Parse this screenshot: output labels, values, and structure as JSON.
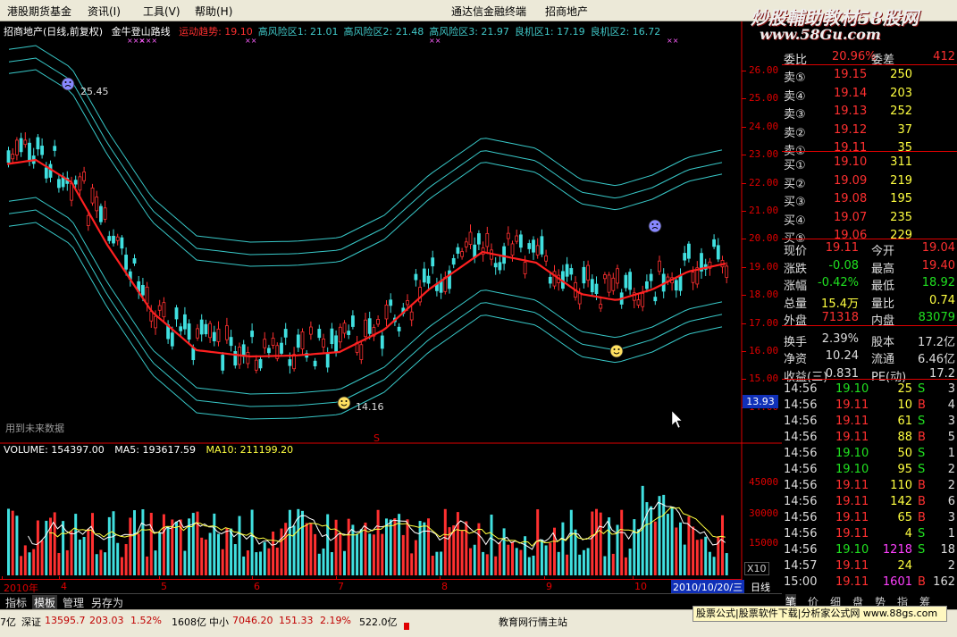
{
  "menu": {
    "items": [
      "港股期货基金",
      "资讯(I)",
      "工具(V)",
      "帮助(H)"
    ],
    "center_a": "通达信金融终端",
    "center_b": "招商地产"
  },
  "watermark": {
    "line1": "炒股輔助教材58股网",
    "line2": "www.58Gu.com"
  },
  "chart": {
    "title": "招商地产(日线,前复权)",
    "indicator_name": "金牛登山路线",
    "indicators": [
      {
        "label": "运动趋势: 19.10",
        "color": "#ff3030"
      },
      {
        "label": "高风险区1: 21.01",
        "color": "#40c8c8"
      },
      {
        "label": "高风险区2: 21.48",
        "color": "#40c8c8"
      },
      {
        "label": "高风险区3: 21.97",
        "color": "#40c8c8"
      },
      {
        "label": "良机区1: 17.19",
        "color": "#40c8c8"
      },
      {
        "label": "良机区2: 16.72",
        "color": "#40c8c8"
      }
    ],
    "high_label": "25.45",
    "low_label": "14.16",
    "current_price": "13.93",
    "price_ticks": [
      "26.00",
      "25.00",
      "24.00",
      "23.00",
      "22.00",
      "21.00",
      "20.00",
      "19.00",
      "18.00",
      "17.00",
      "16.00",
      "15.00",
      "14.00"
    ],
    "future_text": "用到未来数据",
    "volume": {
      "label": "VOLUME: 154397.00",
      "ma5": "MA5: 193617.59",
      "ma10": "MA10: 211199.20",
      "ticks": [
        "45000",
        "30000",
        "15000"
      ],
      "scale": "X10"
    },
    "x_labels": [
      "2010年",
      "4",
      "5",
      "6",
      "7",
      "8",
      "9",
      "10"
    ],
    "date_box": "2010/10/20/三",
    "period": "日线"
  },
  "colors": {
    "up": "#ff3030",
    "down": "#40e0e0",
    "trend": "#ff2020",
    "band": "#38c8c8",
    "axis": "#e00000"
  },
  "quote": {
    "ratio": {
      "l1": "委比",
      "v1": "20.96%",
      "l2": "委差",
      "v2": "412"
    },
    "asks": [
      {
        "l": "卖⑤",
        "p": "19.15",
        "v": "250"
      },
      {
        "l": "卖④",
        "p": "19.14",
        "v": "203"
      },
      {
        "l": "卖③",
        "p": "19.13",
        "v": "252"
      },
      {
        "l": "卖②",
        "p": "19.12",
        "v": "37"
      },
      {
        "l": "卖①",
        "p": "19.11",
        "v": "35"
      }
    ],
    "bids": [
      {
        "l": "买①",
        "p": "19.10",
        "v": "311"
      },
      {
        "l": "买②",
        "p": "19.09",
        "v": "219"
      },
      {
        "l": "买③",
        "p": "19.08",
        "v": "195"
      },
      {
        "l": "买④",
        "p": "19.07",
        "v": "235"
      },
      {
        "l": "买⑤",
        "p": "19.06",
        "v": "229"
      }
    ],
    "stats": [
      {
        "l1": "现价",
        "v1": "19.11",
        "l2": "今开",
        "v2": "19.04",
        "c1": "#ff3030",
        "c2": "#ff3030"
      },
      {
        "l1": "涨跌",
        "v1": "-0.08",
        "l2": "最高",
        "v2": "19.40",
        "c1": "#20e020",
        "c2": "#ff3030"
      },
      {
        "l1": "涨幅",
        "v1": "-0.42%",
        "l2": "最低",
        "v2": "18.92",
        "c1": "#20e020",
        "c2": "#20e020"
      },
      {
        "l1": "总量",
        "v1": "15.4万",
        "l2": "量比",
        "v2": "0.74",
        "c1": "#ffff40",
        "c2": "#ffff40"
      },
      {
        "l1": "外盘",
        "v1": "71318",
        "l2": "内盘",
        "v2": "83079",
        "c1": "#ff3030",
        "c2": "#20e020"
      },
      {
        "l1": "换手",
        "v1": "2.39%",
        "l2": "股本",
        "v2": "17.2亿",
        "c1": "#ddd",
        "c2": "#ddd"
      },
      {
        "l1": "净资",
        "v1": "10.24",
        "l2": "流通",
        "v2": "6.46亿",
        "c1": "#ddd",
        "c2": "#ddd"
      },
      {
        "l1": "收益(三)",
        "v1": "0.831",
        "l2": "PE(动)",
        "v2": "17.2",
        "c1": "#ddd",
        "c2": "#ddd"
      }
    ],
    "ticks": [
      {
        "t": "14:56",
        "p": "19.10",
        "v": "25",
        "s": "S",
        "n": "3"
      },
      {
        "t": "14:56",
        "p": "19.11",
        "v": "10",
        "s": "B",
        "n": "4"
      },
      {
        "t": "14:56",
        "p": "19.11",
        "v": "61",
        "s": "S",
        "n": "3"
      },
      {
        "t": "14:56",
        "p": "19.11",
        "v": "88",
        "s": "B",
        "n": "5"
      },
      {
        "t": "14:56",
        "p": "19.10",
        "v": "50",
        "s": "S",
        "n": "1"
      },
      {
        "t": "14:56",
        "p": "19.10",
        "v": "95",
        "s": "S",
        "n": "2"
      },
      {
        "t": "14:56",
        "p": "19.11",
        "v": "110",
        "s": "B",
        "n": "2"
      },
      {
        "t": "14:56",
        "p": "19.11",
        "v": "142",
        "s": "B",
        "n": "6"
      },
      {
        "t": "14:56",
        "p": "19.11",
        "v": "65",
        "s": "B",
        "n": "3"
      },
      {
        "t": "14:56",
        "p": "19.11",
        "v": "4",
        "s": "S",
        "n": "1"
      },
      {
        "t": "14:56",
        "p": "19.10",
        "v": "1218",
        "s": "S",
        "n": "18"
      },
      {
        "t": "14:57",
        "p": "19.11",
        "v": "24",
        "s": "",
        "n": "2"
      },
      {
        "t": "15:00",
        "p": "19.11",
        "v": "1601",
        "s": "B",
        "n": "162"
      }
    ],
    "bottom_tabs": [
      "笔",
      "价",
      "细",
      "盘",
      "势",
      "指",
      "筹"
    ]
  },
  "tabs": [
    "指标",
    "模板",
    "管理",
    "另存为"
  ],
  "status": {
    "prev": "7亿",
    "sz_label": "深证",
    "sz_val": "13595.7",
    "sz_chg": "203.03",
    "sz_pct": "1.52%",
    "sz_amt": "1608亿",
    "zx_label": "中小",
    "zx_val": "7046.20",
    "zx_chg": "151.33",
    "zx_pct": "2.19%",
    "zx_amt": "522.0亿",
    "notice": "教育网行情主站",
    "ad": "股票公式|股票软件下载|分析家公式网 www.88gs.com"
  }
}
